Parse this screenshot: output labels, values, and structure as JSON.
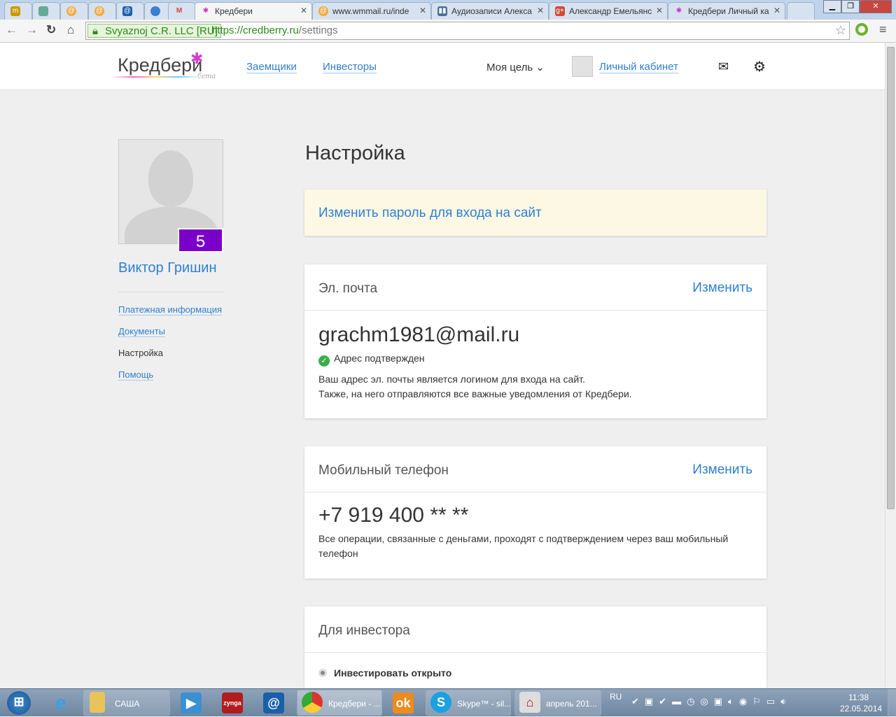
{
  "browser": {
    "tabs": [
      {
        "label": "",
        "icon": "tm-icon"
      },
      {
        "label": "",
        "icon": "image-icon"
      },
      {
        "label": "",
        "icon": "mail-icon"
      },
      {
        "label": "",
        "icon": "mail-icon"
      },
      {
        "label": "",
        "icon": "at-icon"
      },
      {
        "label": "",
        "icon": "globe-icon"
      },
      {
        "label": "",
        "icon": "gmail-icon"
      },
      {
        "label": "Кредбери",
        "icon": "credberry-icon",
        "active": true
      },
      {
        "label": "www.wmmail.ru/inde",
        "icon": "mail-icon"
      },
      {
        "label": "Аудиозаписи Алекса",
        "icon": "vk-icon"
      },
      {
        "label": "Александр Емельянс",
        "icon": "gplus-icon"
      },
      {
        "label": "Кредбери Личный ка",
        "icon": "credberry-icon"
      }
    ],
    "ev_cert": "Svyaznoj C.R. LLC [RU]",
    "url_host": "https://credberry.ru",
    "url_path": "/settings"
  },
  "header": {
    "logo": "Кредбери",
    "beta": "бета",
    "nav": [
      "Заемщики",
      "Инвесторы"
    ],
    "goal": "Моя цель",
    "cabinet": "Личный кабинет"
  },
  "sidebar": {
    "level": "5",
    "name": "Виктор Гришин",
    "links": [
      "Платежная информация",
      "Документы",
      "Настройка",
      "Помощь"
    ]
  },
  "main": {
    "title": "Настройка",
    "password_link": "Изменить пароль для входа на сайт",
    "email": {
      "title": "Эл. почта",
      "edit": "Изменить",
      "value": "grachm1981@mail.ru",
      "status": "Адрес подтвержден",
      "desc1": "Ваш адрес эл. почты является логином для входа на сайт.",
      "desc2": "Также, на него отправляются все важные уведомления от Кредбери."
    },
    "phone": {
      "title": "Мобильный телефон",
      "edit": "Изменить",
      "value": "+7 919 400 ** **",
      "desc": "Все операции, связанные с деньгами, проходят с подтверждением через ваш мобильный телефон"
    },
    "investor": {
      "title": "Для инвестора",
      "option": "Инвестировать открыто"
    }
  },
  "taskbar": {
    "items": [
      "САША",
      "Кредбери - ...",
      "Skype™ - sil...",
      "апрель 201..."
    ],
    "lang": "RU",
    "time": "11:38",
    "date": "22.05.2014"
  }
}
